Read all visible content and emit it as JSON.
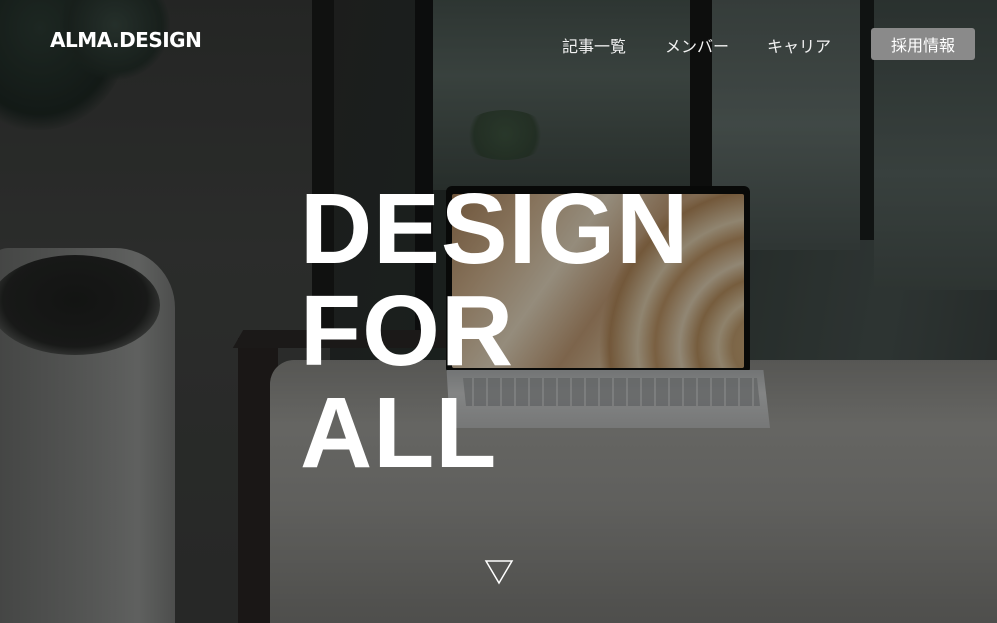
{
  "header": {
    "logo": "ALMA.DESIGN",
    "nav": {
      "articles": "記事一覧",
      "members": "メンバー",
      "career": "キャリア"
    },
    "recruit_button": "採用情報"
  },
  "hero": {
    "headline": [
      "DESIGN",
      "FOR",
      "ALL"
    ],
    "scroll_icon": "triangle-down-outline-icon"
  },
  "colors": {
    "text": "#ffffff",
    "button_bg": "#8a8a8a",
    "overlay": "rgba(0,0,0,0.38)"
  }
}
